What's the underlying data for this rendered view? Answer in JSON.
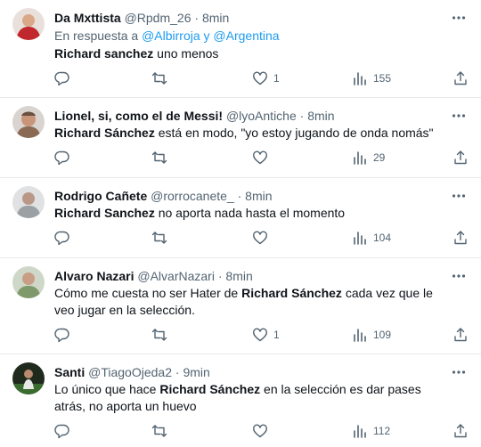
{
  "tweets": [
    {
      "avatar_color": "#c0282d",
      "name": "Da Mxttista",
      "handle": "@Rpdm_26",
      "dot": "·",
      "time": "8min",
      "reply_prefix": "En respuesta a ",
      "reply_mention_1": "@Albirroja",
      "reply_and": " y ",
      "reply_mention_2": "@Argentina",
      "text_bold": "Richard sanchez",
      "text_rest": " uno menos",
      "text_rest_2": "",
      "likes": "1",
      "views": "155"
    },
    {
      "avatar_color": "#8a6a55",
      "name": "Lionel, si, como el de Messi!",
      "handle": "@lyoAntiche",
      "dot": "·",
      "time": "8min",
      "text_bold": "Richard Sánchez",
      "text_rest": " está en modo, \"yo estoy jugando de onda nomás\"",
      "text_rest_2": "",
      "likes": "",
      "views": "29"
    },
    {
      "avatar_color": "#9aa0a3",
      "name": "Rodrigo Cañete",
      "handle": "@rorrocanete_",
      "dot": "·",
      "time": "8min",
      "text_bold": "Richard Sanchez",
      "text_rest": " no aporta nada hasta el momento",
      "text_rest_2": "",
      "likes": "",
      "views": "104"
    },
    {
      "avatar_color": "#7f9a6a",
      "name": "Alvaro Nazari",
      "handle": "@AlvarNazari",
      "dot": "·",
      "time": "8min",
      "text_pre": "Cómo me cuesta no ser Hater de ",
      "text_bold": "Richard Sánchez",
      "text_rest": " cada vez que le veo jugar en la selección.",
      "likes": "1",
      "views": "109"
    },
    {
      "avatar_color": "#2f4a2a",
      "name": "Santi",
      "handle": "@TiagoOjeda2",
      "dot": "·",
      "time": "9min",
      "text_pre": "Lo único que hace ",
      "text_bold": "Richard Sánchez",
      "text_rest": " en la selección es dar pases atrás, no aporta un huevo",
      "likes": "",
      "views": "112"
    }
  ]
}
